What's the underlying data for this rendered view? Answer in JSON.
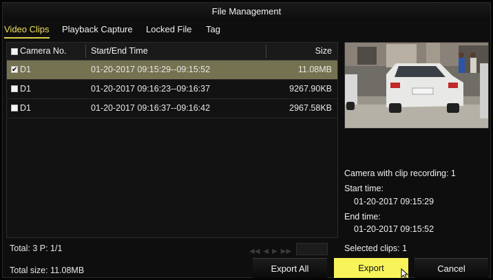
{
  "window": {
    "title": "File Management"
  },
  "tabs": [
    {
      "label": "Video Clips",
      "active": true
    },
    {
      "label": "Playback Capture",
      "active": false
    },
    {
      "label": "Locked File",
      "active": false
    },
    {
      "label": "Tag",
      "active": false
    }
  ],
  "list": {
    "columns": {
      "camera": "Camera No.",
      "time": "Start/End Time",
      "size": "Size"
    },
    "rows": [
      {
        "camera": "D1",
        "time": "01-20-2017 09:15:29--09:15:52",
        "size": "11.08MB",
        "checked": true,
        "selected": true
      },
      {
        "camera": "D1",
        "time": "01-20-2017 09:16:23--09:16:37",
        "size": "9267.90KB",
        "checked": false,
        "selected": false
      },
      {
        "camera": "D1",
        "time": "01-20-2017 09:16:37--09:16:42",
        "size": "2967.58KB",
        "checked": false,
        "selected": false
      }
    ]
  },
  "info": {
    "clip_recording": "Camera with clip recording: 1",
    "start_label": "Start time:",
    "start_value": "01-20-2017 09:15:29",
    "end_label": "End time:",
    "end_value": "01-20-2017 09:15:52",
    "selected_clips": "Selected clips: 1"
  },
  "status": {
    "total": "Total: 3  P: 1/1",
    "total_size": "Total size: 11.08MB"
  },
  "buttons": {
    "export_all": "Export All",
    "export": "Export",
    "cancel": "Cancel"
  },
  "colors": {
    "accent_yellow": "#f8f35a",
    "selected_row": "#747250",
    "tab_active": "#f0e060"
  }
}
